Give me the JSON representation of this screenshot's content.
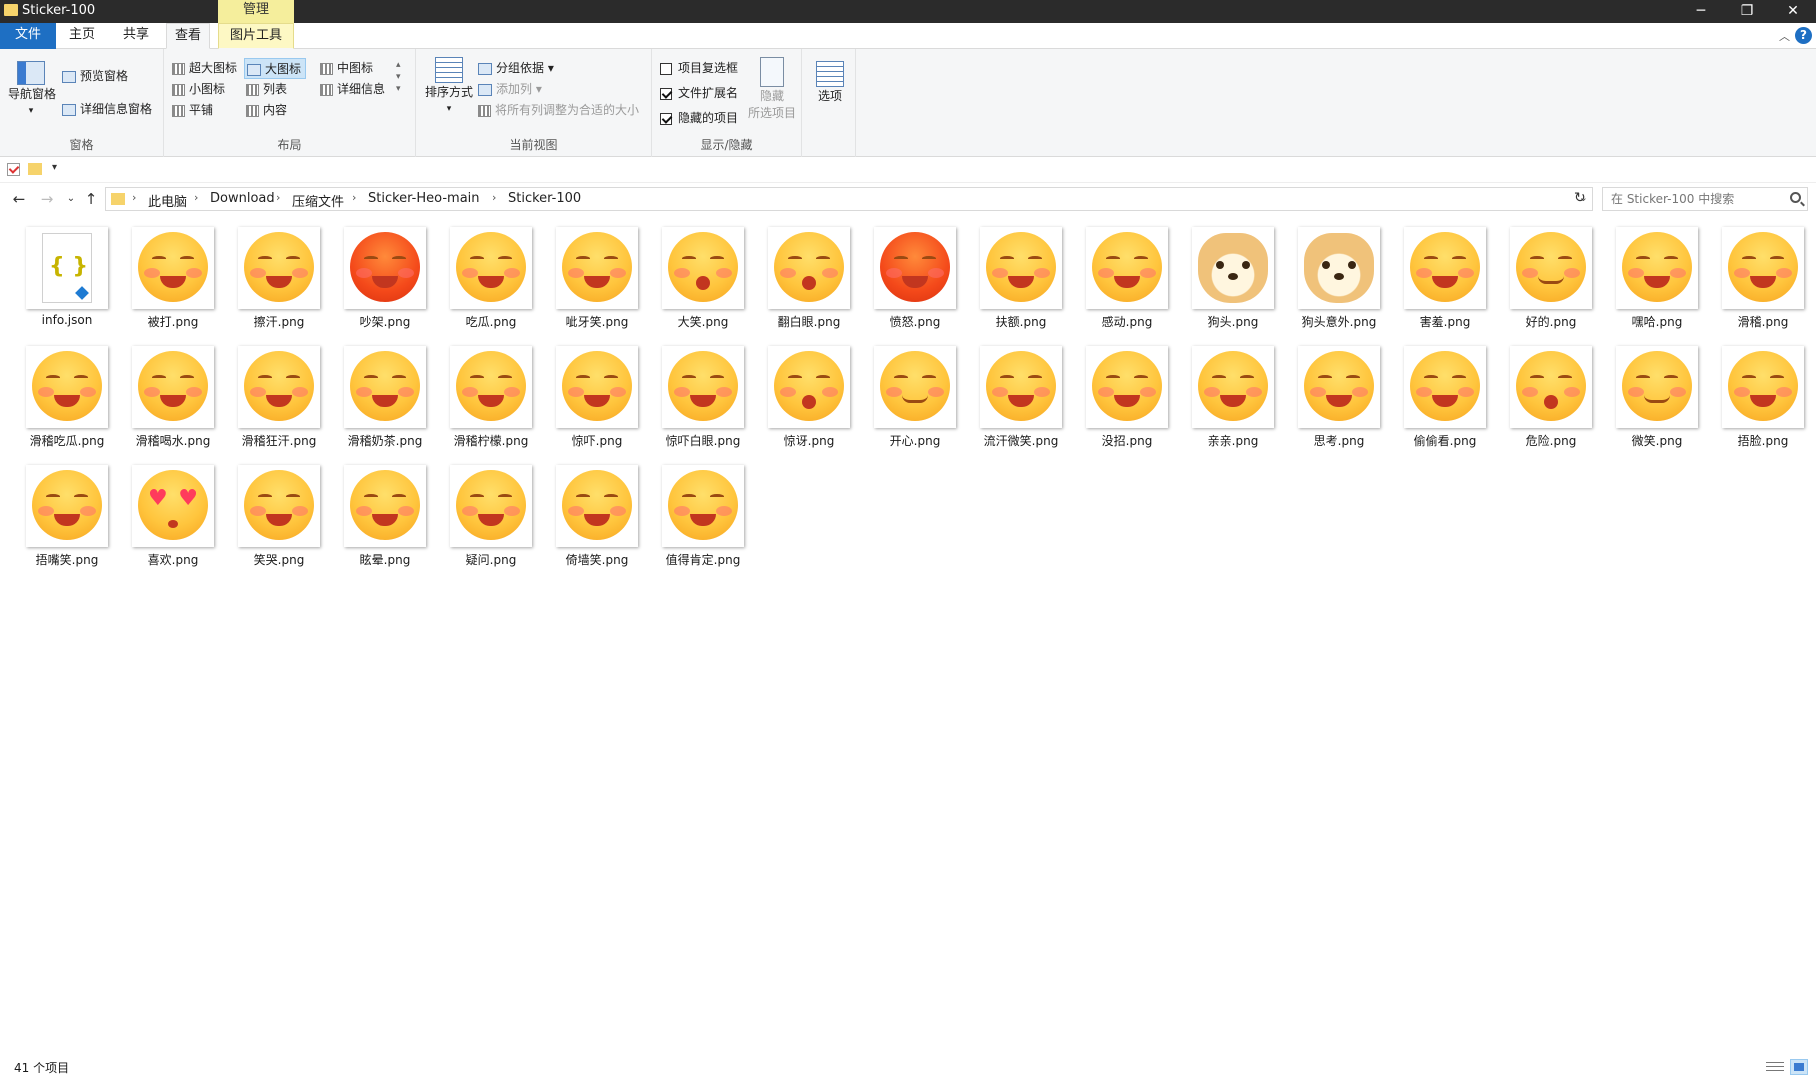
{
  "window": {
    "title": "Sticker-100",
    "context_tab": "管理",
    "controls": {
      "minimize": "─",
      "maximize": "❐",
      "close": "✕"
    }
  },
  "tabs": [
    {
      "label": "文件"
    },
    {
      "label": "主页"
    },
    {
      "label": "共享"
    },
    {
      "label": "查看"
    },
    {
      "label": "图片工具"
    }
  ],
  "help": "?",
  "ribbon": {
    "panes": {
      "label": "窗格",
      "nav_pane": "导航窗格",
      "preview_pane": "预览窗格",
      "details_pane": "详细信息窗格"
    },
    "layout": {
      "label": "布局",
      "items": [
        "超大图标",
        "大图标",
        "中图标",
        "小图标",
        "列表",
        "详细信息",
        "平铺",
        "内容"
      ],
      "selected": "大图标"
    },
    "current_view": {
      "label": "当前视图",
      "sort_by": "排序方式",
      "group_by": "分组依据",
      "add_column": "添加列",
      "size_columns": "将所有列调整为合适的大小"
    },
    "show_hide": {
      "label": "显示/隐藏",
      "item_checkboxes": "项目复选框",
      "item_checkboxes_checked": false,
      "file_extensions": "文件扩展名",
      "file_extensions_checked": true,
      "hidden_items": "隐藏的项目",
      "hidden_items_checked": true,
      "hide_selected_line1": "隐藏",
      "hide_selected_line2": "所选项目"
    },
    "options": "选项"
  },
  "address": {
    "crumbs": [
      "此电脑",
      "Download",
      "压缩文件",
      "Sticker-Heo-main",
      "Sticker-100"
    ],
    "search_placeholder": "在 Sticker-100 中搜索"
  },
  "files": [
    "info.json",
    "被打.png",
    "擦汗.png",
    "吵架.png",
    "吃瓜.png",
    "呲牙笑.png",
    "大笑.png",
    "翻白眼.png",
    "愤怒.png",
    "扶额.png",
    "感动.png",
    "狗头.png",
    "狗头意外.png",
    "害羞.png",
    "好的.png",
    "嘿哈.png",
    "滑稽.png",
    "滑稽吃瓜.png",
    "滑稽喝水.png",
    "滑稽狂汗.png",
    "滑稽奶茶.png",
    "滑稽柠檬.png",
    "惊吓.png",
    "惊吓白眼.png",
    "惊讶.png",
    "开心.png",
    "流汗微笑.png",
    "没招.png",
    "亲亲.png",
    "思考.png",
    "偷偷看.png",
    "危险.png",
    "微笑.png",
    "捂脸.png",
    "捂嘴笑.png",
    "喜欢.png",
    "笑哭.png",
    "眩晕.png",
    "疑问.png",
    "倚墙笑.png",
    "值得肯定.png"
  ],
  "status": {
    "item_count": "41 个项目"
  },
  "colors": {
    "accent": "#1e6fc3",
    "titlebar": "#2b2b2b",
    "context_tab": "#f5ee9c"
  }
}
